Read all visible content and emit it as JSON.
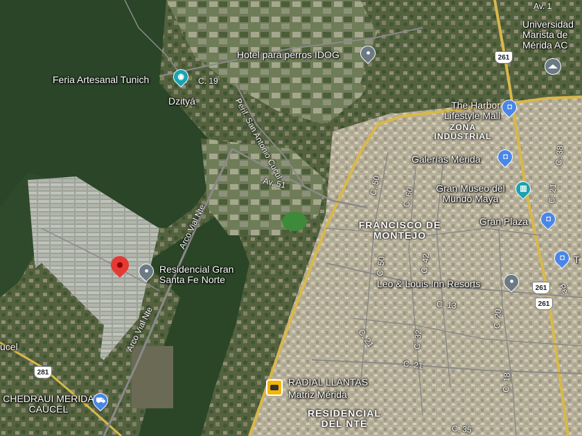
{
  "places": {
    "hotel_perros": "Hotel para perros IDOG",
    "feria": "Feria Artesanal Tunich",
    "dzitya": "Dzityá",
    "universidad": "Universidad Marista de Mérida AC",
    "harbor": "The Harbor Lifestyle Mall",
    "galerias": "Galerías Mérida",
    "gran_museo": "Gran Museo del Mundo Maya",
    "gran_plaza": "Gran Plaza",
    "residencial_gsf": "Residencial Gran Santa Fe Norte",
    "leo_louis": "Leo & Louis Inn Resorts",
    "radial": "RADIAL LLANTAS",
    "radial_sub": "Matriz Mérida",
    "chedraui": "CHEDRAUI MERIDA CAUCEL",
    "caucel": "ucel",
    "edge_t": "T"
  },
  "areas": {
    "zona_industrial": "ZONA INDUSTRIAL",
    "francisco_montejo": "FRANCISCO DE MONTEJO",
    "residencial_nte": "RESIDENCIAL DEL NTE"
  },
  "roads": {
    "c19": "C. 19",
    "periferico": "Perif. San Antonio Cucul",
    "av51": "Av. 51",
    "arco_vial_1": "Arco Vial Nte",
    "arco_vial_2": "Arco Vial Nte",
    "c50": "C. 50",
    "c60": "C. 60",
    "c50b": "C. 50",
    "c42": "C. 42",
    "c38": "C. 38",
    "c13": "C. 13",
    "c21a": "C. 21",
    "c21b": "C. 21",
    "c32": "C. 32",
    "c20": "C. 20",
    "c35": "C. 35",
    "c18": "C. 18",
    "av1": "Av. 1",
    "pe": "Pe",
    "c21c": "C. 21"
  },
  "shields": {
    "s261a": "261",
    "s261b": "261",
    "s261c": "261",
    "s281": "281"
  },
  "icons": {
    "feria": "camera-icon",
    "hotel": "map-pin-icon",
    "universidad": "graduation-cap-icon",
    "harbor": "shopping-bag-icon",
    "galerias": "shopping-bag-icon",
    "gran_museo": "museum-icon",
    "gran_plaza": "shopping-bag-icon",
    "residencial": "map-pin-icon",
    "selected": "red-location-pin-icon",
    "leo_louis": "map-pin-icon",
    "radial": "tire-shop-icon",
    "chedraui": "shopping-cart-icon"
  },
  "colors": {
    "vegetation": "#2f4a2b",
    "urban": "#b6b09a",
    "highway": "#d9b84a",
    "street": "#7d7d7d",
    "selected_pin": "#e53935",
    "poi_pin": "#6b7a85",
    "shop_pin": "#4a86e8"
  }
}
